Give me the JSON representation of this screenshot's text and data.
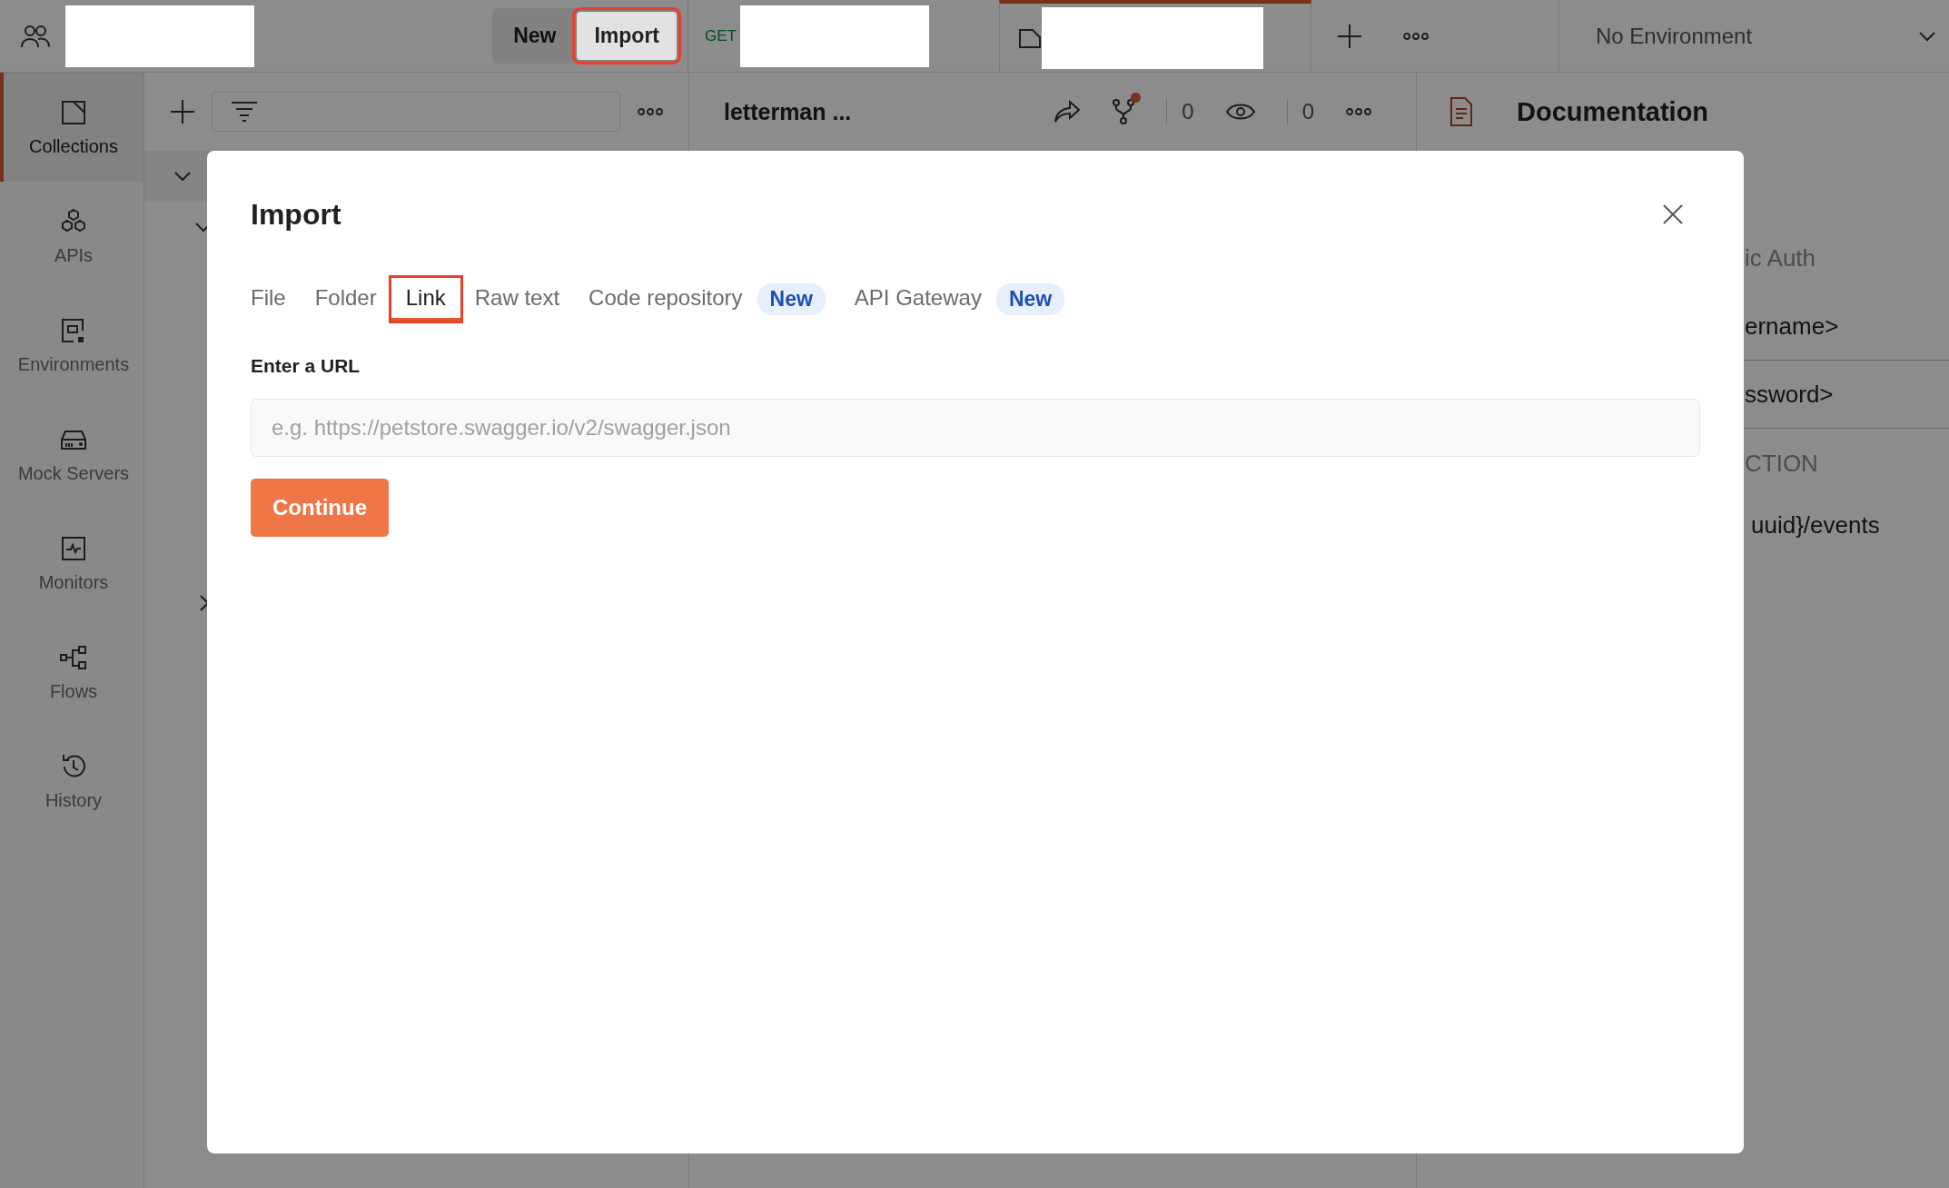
{
  "top_bar": {
    "buttons": [
      {
        "label": "New",
        "highlighted": false
      },
      {
        "label": "Import",
        "highlighted": true
      }
    ],
    "request_method": "GET",
    "environment": "No Environment"
  },
  "sidebar": {
    "items": [
      {
        "label": "Collections",
        "selected": true
      },
      {
        "label": "APIs",
        "selected": false
      },
      {
        "label": "Environments",
        "selected": false
      },
      {
        "label": "Mock Servers",
        "selected": false
      },
      {
        "label": "Monitors",
        "selected": false
      },
      {
        "label": "Flows",
        "selected": false
      },
      {
        "label": "History",
        "selected": false
      }
    ]
  },
  "request_toolbar": {
    "title": "letterman ...",
    "fork_dot": true,
    "fork_count": "0",
    "watch_count": "0"
  },
  "documentation": {
    "title": "Documentation",
    "lines": [
      {
        "kind": "muted",
        "text": "ic Auth"
      },
      {
        "kind": "row",
        "text": "ername>"
      },
      {
        "kind": "row",
        "text": "ssword>"
      },
      {
        "kind": "muted",
        "text": "CTION"
      },
      {
        "kind": "text",
        "text": "uuid}/events"
      }
    ]
  },
  "import_dialog": {
    "title": "Import",
    "tabs": [
      {
        "label": "File",
        "selected": false,
        "highlighted": false
      },
      {
        "label": "Folder",
        "selected": false,
        "highlighted": false
      },
      {
        "label": "Link",
        "selected": true,
        "highlighted": true
      },
      {
        "label": "Raw text",
        "selected": false,
        "highlighted": false
      },
      {
        "label": "Code repository",
        "selected": false,
        "highlighted": false,
        "badge": "New"
      },
      {
        "label": "API Gateway",
        "selected": false,
        "highlighted": false,
        "badge": "New"
      }
    ],
    "url_label": "Enter a URL",
    "url_field": {
      "placeholder": "e.g. https://petstore.swagger.io/v2/swagger.json"
    },
    "continue_button": "Continue"
  }
}
